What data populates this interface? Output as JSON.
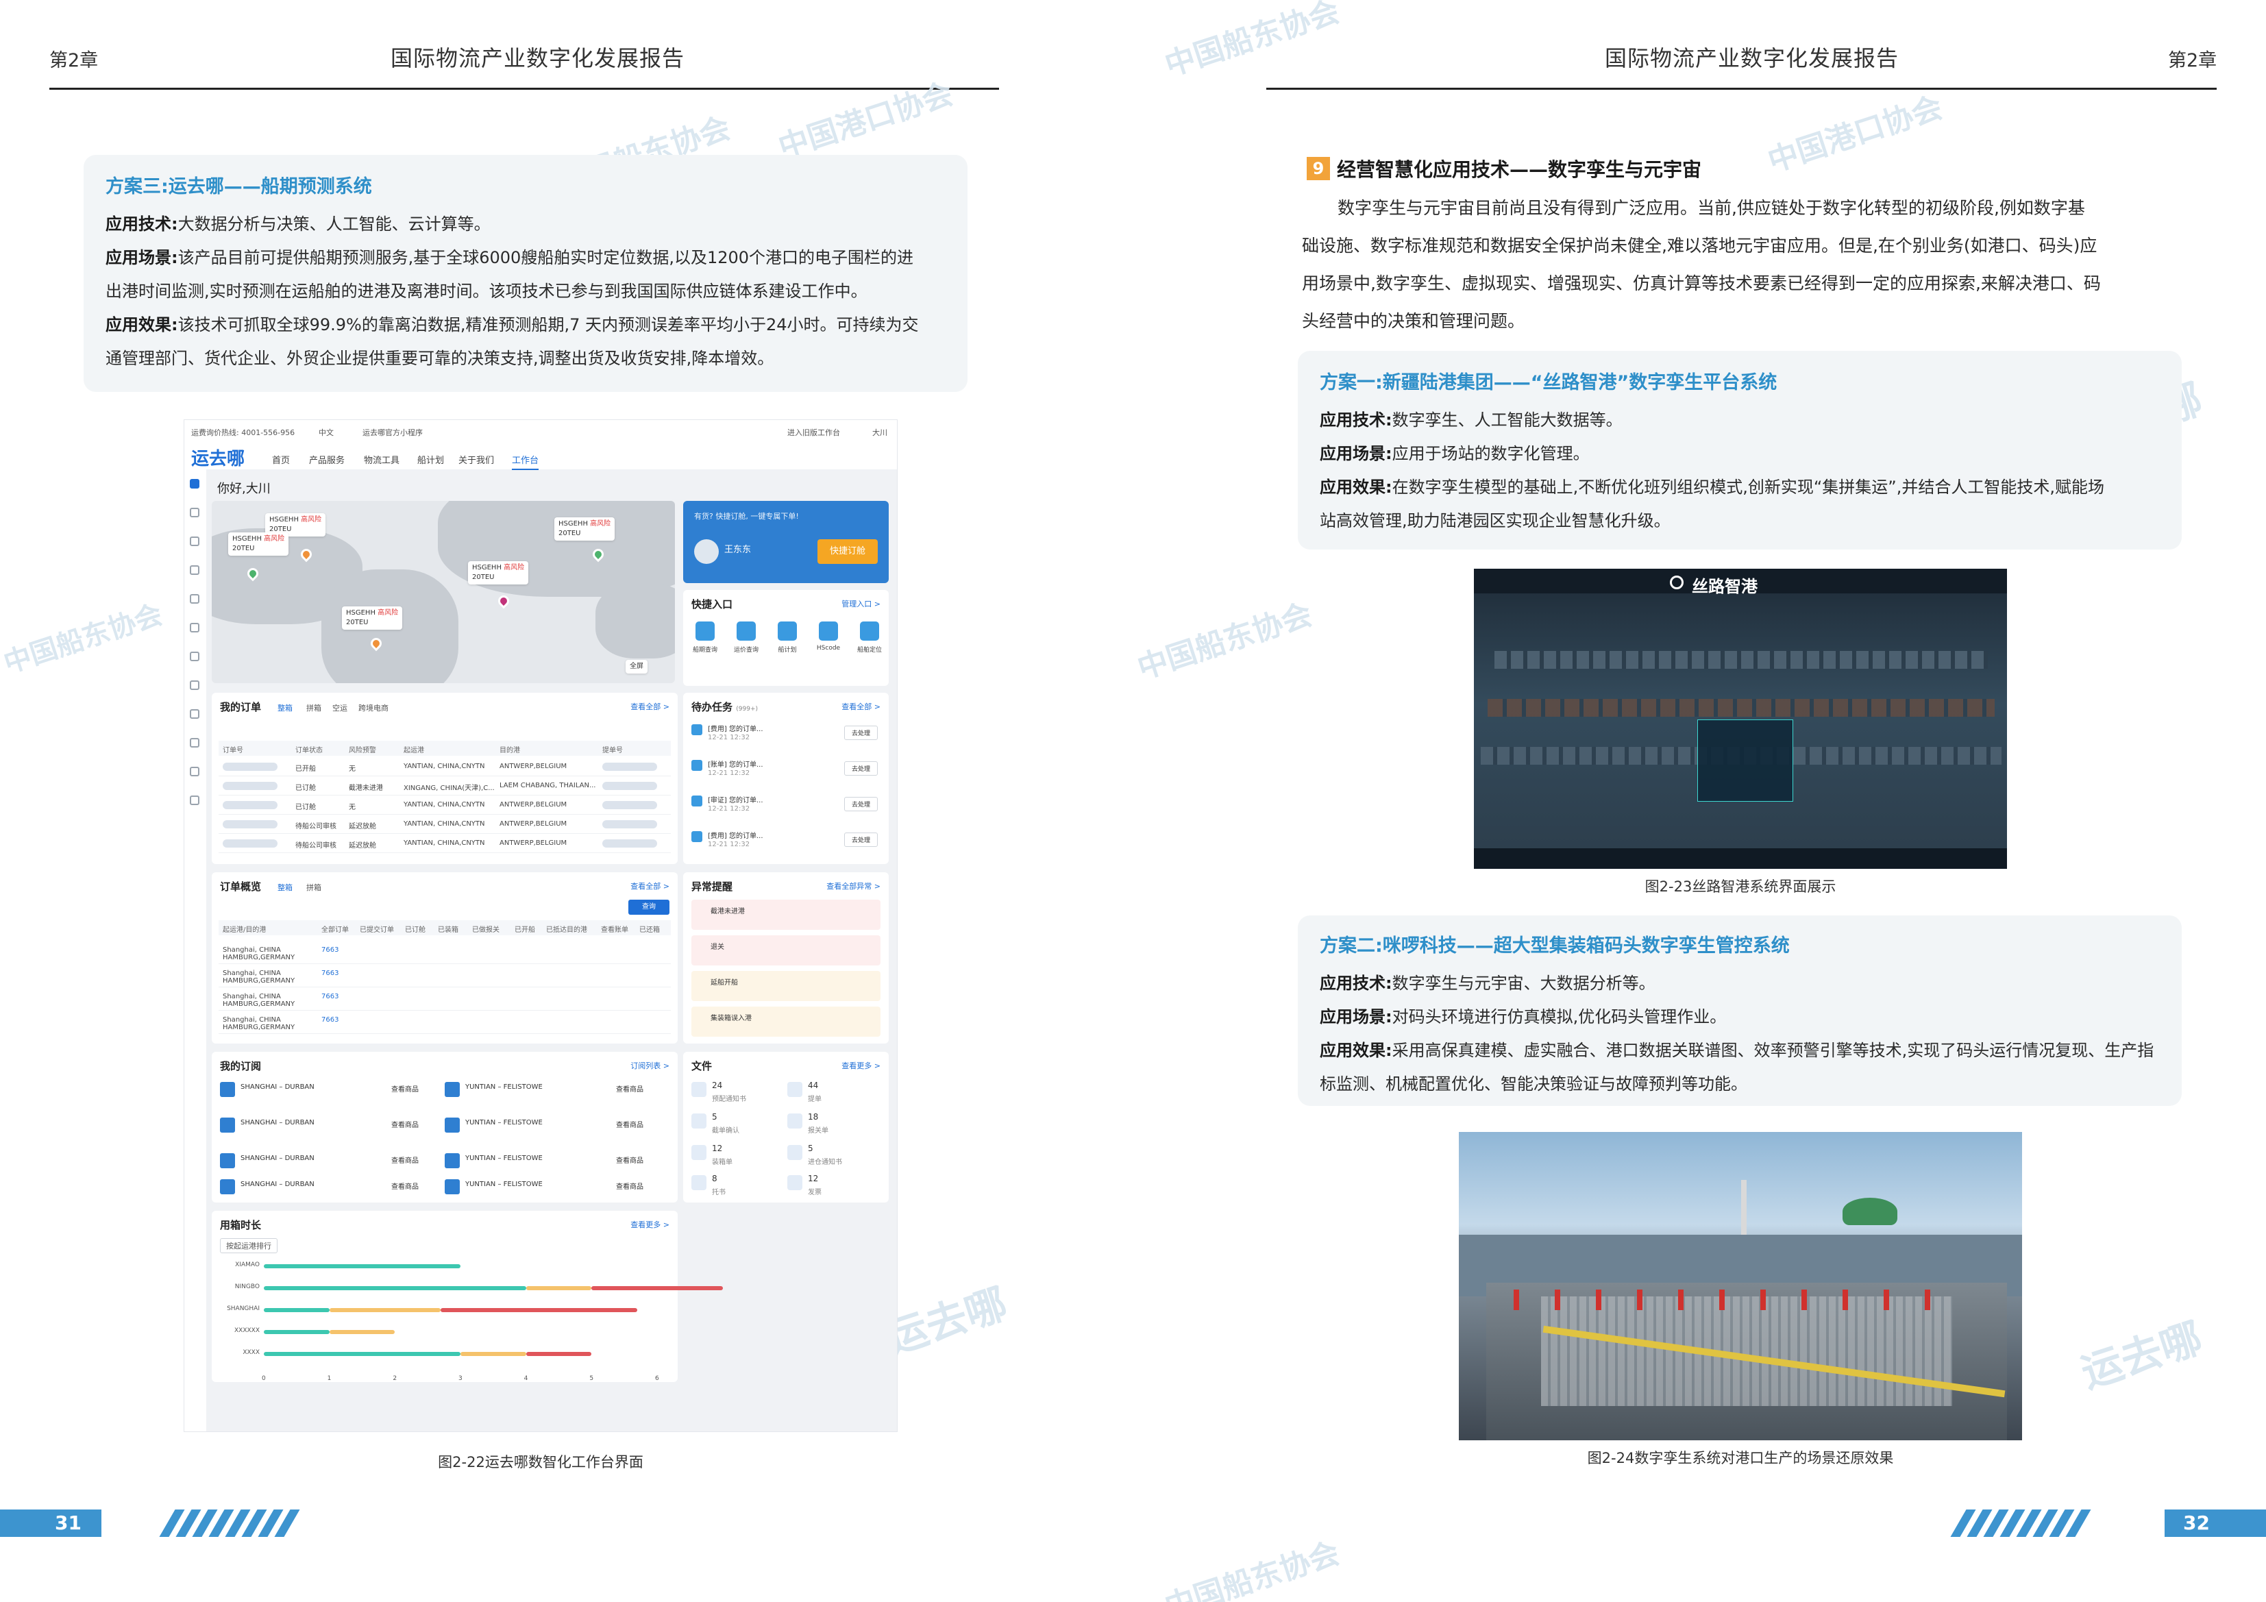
{
  "header": {
    "chapter_left": "第2章",
    "title_left": "国际物流产业数字化发展报告",
    "chapter_right": "第2章",
    "title_right": "国际物流产业数字化发展报告"
  },
  "left_page": {
    "case3": {
      "title": "方案三:运去哪——船期预测系统",
      "tech_label": "应用技术:",
      "tech_text": "大数据分析与决策、人工智能、云计算等。",
      "scene_label": "应用场景:",
      "scene_text_1": "该产品目前可提供船期预测服务,基于全球6000艘船舶实时定位数据,以及1200个港口的电子围栏的进",
      "scene_text_2": "出港时间监测,实时预测在运船舶的进港及离港时间。该项技术已参与到我国国际供应链体系建设工作中。",
      "effect_label": "应用效果:",
      "effect_text_1": "该技术可抓取全球99.9%的靠离泊数据,精准预测船期,7 天内预测误差率平均小于24小时。可持续为交",
      "effect_text_2": "通管理部门、货代企业、外贸企业提供重要可靠的决策支持,调整出货及收货安排,降本增效。"
    },
    "figure_caption": "图2-22运去哪数智化工作台界面",
    "page_number": "31"
  },
  "app": {
    "hotline": "运费询价热线: 4001-556-956",
    "lang": "中文",
    "mini_program": "运去哪官方小程序",
    "top_right": "进入旧版工作台",
    "user": "大川",
    "logo": "运去哪",
    "nav": [
      "首页",
      "产品服务",
      "物流工具",
      "船计划",
      "关于我们",
      "工作台"
    ],
    "greeting": "你好,大川",
    "ships": [
      {
        "name": "HSGEHH",
        "risk": "高风险",
        "teu": "20TEU"
      },
      {
        "name": "HSGEHH",
        "risk": "高风险",
        "teu": "20TEU"
      },
      {
        "name": "HSGEHH",
        "risk": "高风险",
        "teu": "20TEU"
      },
      {
        "name": "HSGEHH",
        "risk": "高风险",
        "teu": "20TEU"
      },
      {
        "name": "HSGEHH",
        "risk": "高风险",
        "teu": "20TEU"
      }
    ],
    "map_fullscreen": "全屏",
    "promo_text": "有货? 快捷订舱, 一键专属下单!",
    "promo_name": "王东东",
    "promo_button": "快捷订舱",
    "quick_entry_title": "快捷入口",
    "quick_entry_link": "管理入口 >",
    "quick_items": [
      "船期查询",
      "运价查询",
      "船计划",
      "HScode",
      "船舶定位"
    ],
    "orders_title": "我的订单",
    "orders_tabs": [
      "整箱",
      "拼箱",
      "空运",
      "跨境电商"
    ],
    "orders_link": "查看全部 >",
    "orders_columns": [
      "订单号",
      "订单状态",
      "风险预警",
      "起运港",
      "目的港",
      "提单号"
    ],
    "orders_rows": [
      {
        "status": "已开船",
        "risk": "无",
        "from": "YANTIAN, CHINA,CNYTN",
        "to": "ANTWERP,BELGIUM"
      },
      {
        "status": "已订舱",
        "risk": "截港未进港",
        "from": "XINGANG, CHINA(天津),C...",
        "to": "LAEM CHABANG, THAILAN..."
      },
      {
        "status": "已订舱",
        "risk": "无",
        "from": "YANTIAN, CHINA,CNYTN",
        "to": "ANTWERP,BELGIUM"
      },
      {
        "status": "待船公司审核",
        "risk": "延迟放舱",
        "from": "YANTIAN, CHINA,CNYTN",
        "to": "ANTWERP,BELGIUM"
      },
      {
        "status": "待船公司审核",
        "risk": "延迟放舱",
        "from": "YANTIAN, CHINA,CNYTN",
        "to": "ANTWERP,BELGIUM"
      }
    ],
    "todo_title": "待办任务",
    "todo_count": "(999+)",
    "todo_link": "查看全部 >",
    "todo_items": [
      {
        "text": "[费用] 您的订单...",
        "date": "12-21 12:32",
        "btn": "去处理"
      },
      {
        "text": "[账单] 您的订单...",
        "date": "12-21 12:32",
        "btn": "去处理"
      },
      {
        "text": "[审证] 您的订单...",
        "date": "12-21 12:32",
        "btn": "去处理"
      },
      {
        "text": "[费用] 您的订单...",
        "date": "12-21 12:32",
        "btn": "去处理"
      }
    ],
    "overview_title": "订单概览",
    "overview_tabs": [
      "整箱",
      "拼箱"
    ],
    "overview_link": "查看全部 >",
    "overview_button": "查询",
    "overview_columns": [
      "起运港/目的港",
      "全部订单",
      "已提交订单",
      "已订舱",
      "已装箱",
      "已做报关",
      "已开船",
      "已抵达目的港",
      "查看账单",
      "已还箱"
    ],
    "overview_rows": [
      {
        "route": "Shanghai, CHINA HAMBURG,GERMANY",
        "total": "7663"
      },
      {
        "route": "Shanghai, CHINA HAMBURG,GERMANY",
        "total": "7663"
      },
      {
        "route": "Shanghai, CHINA HAMBURG,GERMANY",
        "total": "7663"
      },
      {
        "route": "Shanghai, CHINA HAMBURG,GERMANY",
        "total": "7663"
      }
    ],
    "alerts_title": "异常提醒",
    "alerts_link": "查看全部异常 >",
    "alerts": [
      "截港未进港",
      "退关",
      "延船开船",
      "集装箱误入港"
    ],
    "subs_title": "我的订阅",
    "subs_link": "订阅列表 >",
    "subs": [
      {
        "route": "SHANGHAI – DURBAN",
        "action": "查看商品"
      },
      {
        "route": "YUNTIAN – FELISTOWE",
        "action": "查看商品"
      },
      {
        "route": "SHANGHAI – DURBAN",
        "action": "查看商品"
      },
      {
        "route": "YUNTIAN – FELISTOWE",
        "action": "查看商品"
      },
      {
        "route": "SHANGHAI – DURBAN",
        "action": "查看商品"
      },
      {
        "route": "YUNTIAN – FELISTOWE",
        "action": "查看商品"
      },
      {
        "route": "SHANGHAI – DURBAN",
        "action": "查看商品"
      },
      {
        "route": "YUNTIAN – FELISTOWE",
        "action": "查看商品"
      }
    ],
    "files_title": "文件",
    "files_link": "查看更多 >",
    "files": [
      {
        "count": "24",
        "label": "预配通知书"
      },
      {
        "count": "44",
        "label": "提单"
      },
      {
        "count": "5",
        "label": "截单确认"
      },
      {
        "count": "18",
        "label": "报关单"
      },
      {
        "count": "12",
        "label": "装箱单"
      },
      {
        "count": "5",
        "label": "进仓通知书"
      },
      {
        "count": "8",
        "label": "托书"
      },
      {
        "count": "12",
        "label": "发票"
      }
    ],
    "usage_title": "用箱时长",
    "usage_link": "查看更多 >",
    "usage_filter": "按起运港排行",
    "usage_bars": [
      {
        "port": "XIAMAO",
        "values": [
          3,
          0,
          0
        ]
      },
      {
        "port": "NINGBO",
        "values": [
          4,
          1,
          2
        ]
      },
      {
        "port": "SHANGHAI",
        "values": [
          1,
          1.7,
          3
        ]
      },
      {
        "port": "XXXXXX",
        "values": [
          1,
          1,
          0
        ]
      },
      {
        "port": "XXXX",
        "values": [
          3,
          1,
          1
        ]
      }
    ],
    "usage_ticks": [
      "0",
      "1",
      "2",
      "3",
      "4",
      "5",
      "6"
    ],
    "colors": {
      "series": [
        "#3cc7b0",
        "#f5c26b",
        "#e0555a"
      ],
      "accent": "#1f6fd6"
    }
  },
  "right_page": {
    "section_number": "9",
    "section_title": "经营智慧化应用技术——数字孪生与元宇宙",
    "para_1": "数字孪生与元宇宙目前尚且没有得到广泛应用。当前,供应链处于数字化转型的初级阶段,例如数字基",
    "para_2": "础设施、数字标准规范和数据安全保护尚未健全,难以落地元宇宙应用。但是,在个别业务(如港口、码头)应",
    "para_3": "用场景中,数字孪生、虚拟现实、增强现实、仿真计算等技术要素已经得到一定的应用探索,来解决港口、码",
    "para_4": "头经营中的决策和管理问题。",
    "case1": {
      "title": "方案一:新疆陆港集团——“丝路智港”数字孪生平台系统",
      "tech_label": "应用技术:",
      "tech_text": "数字孪生、人工智能大数据等。",
      "scene_label": "应用场景:",
      "scene_text": "应用于场站的数字化管理。",
      "effect_label": "应用效果:",
      "effect_text_1": "在数字孪生模型的基础上,不断优化班列组织模式,创新实现“集拼集运”,并结合人工智能技术,赋能场",
      "effect_text_2": "站高效管理,助力陆港园区实现企业智慧化升级。"
    },
    "fig23_brand": "丝路智港",
    "fig23_caption": "图2-23丝路智港系统界面展示",
    "case2": {
      "title": "方案二:咪啰科技——超大型集装箱码头数字孪生管控系统",
      "tech_label": "应用技术:",
      "tech_text": "数字孪生与元宇宙、大数据分析等。",
      "scene_label": "应用场景:",
      "scene_text": "对码头环境进行仿真模拟,优化码头管理作业。",
      "effect_label": "应用效果:",
      "effect_text_1": "采用高保真建模、虚实融合、港口数据关联谱图、效率预警引擎等技术,实现了码头运行情况复现、生产指",
      "effect_text_2": "标监测、机械配置优化、智能决策验证与故障预判等功能。"
    },
    "fig24_caption": "图2-24数字孪生系统对港口生产的场景还原效果",
    "page_number": "32"
  },
  "watermarks": [
    "中国船东协会",
    "中国港口协会",
    "运去哪"
  ]
}
